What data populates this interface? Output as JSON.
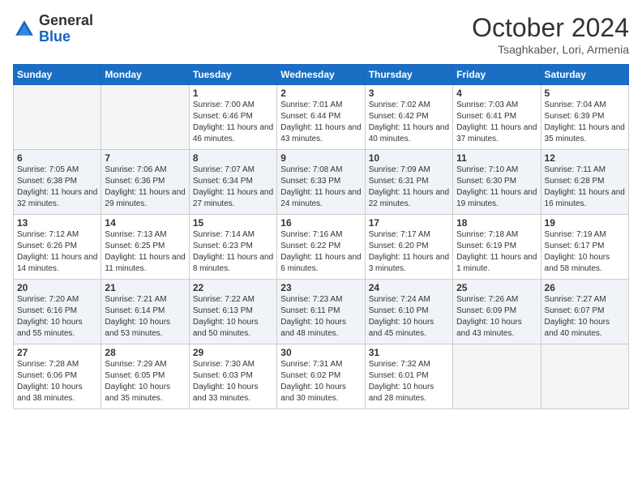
{
  "header": {
    "logo_general": "General",
    "logo_blue": "Blue",
    "month_title": "October 2024",
    "location": "Tsaghkaber, Lori, Armenia"
  },
  "days_of_week": [
    "Sunday",
    "Monday",
    "Tuesday",
    "Wednesday",
    "Thursday",
    "Friday",
    "Saturday"
  ],
  "weeks": [
    [
      {
        "day": "",
        "sunrise": "",
        "sunset": "",
        "daylight": ""
      },
      {
        "day": "",
        "sunrise": "",
        "sunset": "",
        "daylight": ""
      },
      {
        "day": "1",
        "sunrise": "Sunrise: 7:00 AM",
        "sunset": "Sunset: 6:46 PM",
        "daylight": "Daylight: 11 hours and 46 minutes."
      },
      {
        "day": "2",
        "sunrise": "Sunrise: 7:01 AM",
        "sunset": "Sunset: 6:44 PM",
        "daylight": "Daylight: 11 hours and 43 minutes."
      },
      {
        "day": "3",
        "sunrise": "Sunrise: 7:02 AM",
        "sunset": "Sunset: 6:42 PM",
        "daylight": "Daylight: 11 hours and 40 minutes."
      },
      {
        "day": "4",
        "sunrise": "Sunrise: 7:03 AM",
        "sunset": "Sunset: 6:41 PM",
        "daylight": "Daylight: 11 hours and 37 minutes."
      },
      {
        "day": "5",
        "sunrise": "Sunrise: 7:04 AM",
        "sunset": "Sunset: 6:39 PM",
        "daylight": "Daylight: 11 hours and 35 minutes."
      }
    ],
    [
      {
        "day": "6",
        "sunrise": "Sunrise: 7:05 AM",
        "sunset": "Sunset: 6:38 PM",
        "daylight": "Daylight: 11 hours and 32 minutes."
      },
      {
        "day": "7",
        "sunrise": "Sunrise: 7:06 AM",
        "sunset": "Sunset: 6:36 PM",
        "daylight": "Daylight: 11 hours and 29 minutes."
      },
      {
        "day": "8",
        "sunrise": "Sunrise: 7:07 AM",
        "sunset": "Sunset: 6:34 PM",
        "daylight": "Daylight: 11 hours and 27 minutes."
      },
      {
        "day": "9",
        "sunrise": "Sunrise: 7:08 AM",
        "sunset": "Sunset: 6:33 PM",
        "daylight": "Daylight: 11 hours and 24 minutes."
      },
      {
        "day": "10",
        "sunrise": "Sunrise: 7:09 AM",
        "sunset": "Sunset: 6:31 PM",
        "daylight": "Daylight: 11 hours and 22 minutes."
      },
      {
        "day": "11",
        "sunrise": "Sunrise: 7:10 AM",
        "sunset": "Sunset: 6:30 PM",
        "daylight": "Daylight: 11 hours and 19 minutes."
      },
      {
        "day": "12",
        "sunrise": "Sunrise: 7:11 AM",
        "sunset": "Sunset: 6:28 PM",
        "daylight": "Daylight: 11 hours and 16 minutes."
      }
    ],
    [
      {
        "day": "13",
        "sunrise": "Sunrise: 7:12 AM",
        "sunset": "Sunset: 6:26 PM",
        "daylight": "Daylight: 11 hours and 14 minutes."
      },
      {
        "day": "14",
        "sunrise": "Sunrise: 7:13 AM",
        "sunset": "Sunset: 6:25 PM",
        "daylight": "Daylight: 11 hours and 11 minutes."
      },
      {
        "day": "15",
        "sunrise": "Sunrise: 7:14 AM",
        "sunset": "Sunset: 6:23 PM",
        "daylight": "Daylight: 11 hours and 8 minutes."
      },
      {
        "day": "16",
        "sunrise": "Sunrise: 7:16 AM",
        "sunset": "Sunset: 6:22 PM",
        "daylight": "Daylight: 11 hours and 6 minutes."
      },
      {
        "day": "17",
        "sunrise": "Sunrise: 7:17 AM",
        "sunset": "Sunset: 6:20 PM",
        "daylight": "Daylight: 11 hours and 3 minutes."
      },
      {
        "day": "18",
        "sunrise": "Sunrise: 7:18 AM",
        "sunset": "Sunset: 6:19 PM",
        "daylight": "Daylight: 11 hours and 1 minute."
      },
      {
        "day": "19",
        "sunrise": "Sunrise: 7:19 AM",
        "sunset": "Sunset: 6:17 PM",
        "daylight": "Daylight: 10 hours and 58 minutes."
      }
    ],
    [
      {
        "day": "20",
        "sunrise": "Sunrise: 7:20 AM",
        "sunset": "Sunset: 6:16 PM",
        "daylight": "Daylight: 10 hours and 55 minutes."
      },
      {
        "day": "21",
        "sunrise": "Sunrise: 7:21 AM",
        "sunset": "Sunset: 6:14 PM",
        "daylight": "Daylight: 10 hours and 53 minutes."
      },
      {
        "day": "22",
        "sunrise": "Sunrise: 7:22 AM",
        "sunset": "Sunset: 6:13 PM",
        "daylight": "Daylight: 10 hours and 50 minutes."
      },
      {
        "day": "23",
        "sunrise": "Sunrise: 7:23 AM",
        "sunset": "Sunset: 6:11 PM",
        "daylight": "Daylight: 10 hours and 48 minutes."
      },
      {
        "day": "24",
        "sunrise": "Sunrise: 7:24 AM",
        "sunset": "Sunset: 6:10 PM",
        "daylight": "Daylight: 10 hours and 45 minutes."
      },
      {
        "day": "25",
        "sunrise": "Sunrise: 7:26 AM",
        "sunset": "Sunset: 6:09 PM",
        "daylight": "Daylight: 10 hours and 43 minutes."
      },
      {
        "day": "26",
        "sunrise": "Sunrise: 7:27 AM",
        "sunset": "Sunset: 6:07 PM",
        "daylight": "Daylight: 10 hours and 40 minutes."
      }
    ],
    [
      {
        "day": "27",
        "sunrise": "Sunrise: 7:28 AM",
        "sunset": "Sunset: 6:06 PM",
        "daylight": "Daylight: 10 hours and 38 minutes."
      },
      {
        "day": "28",
        "sunrise": "Sunrise: 7:29 AM",
        "sunset": "Sunset: 6:05 PM",
        "daylight": "Daylight: 10 hours and 35 minutes."
      },
      {
        "day": "29",
        "sunrise": "Sunrise: 7:30 AM",
        "sunset": "Sunset: 6:03 PM",
        "daylight": "Daylight: 10 hours and 33 minutes."
      },
      {
        "day": "30",
        "sunrise": "Sunrise: 7:31 AM",
        "sunset": "Sunset: 6:02 PM",
        "daylight": "Daylight: 10 hours and 30 minutes."
      },
      {
        "day": "31",
        "sunrise": "Sunrise: 7:32 AM",
        "sunset": "Sunset: 6:01 PM",
        "daylight": "Daylight: 10 hours and 28 minutes."
      },
      {
        "day": "",
        "sunrise": "",
        "sunset": "",
        "daylight": ""
      },
      {
        "day": "",
        "sunrise": "",
        "sunset": "",
        "daylight": ""
      }
    ]
  ]
}
